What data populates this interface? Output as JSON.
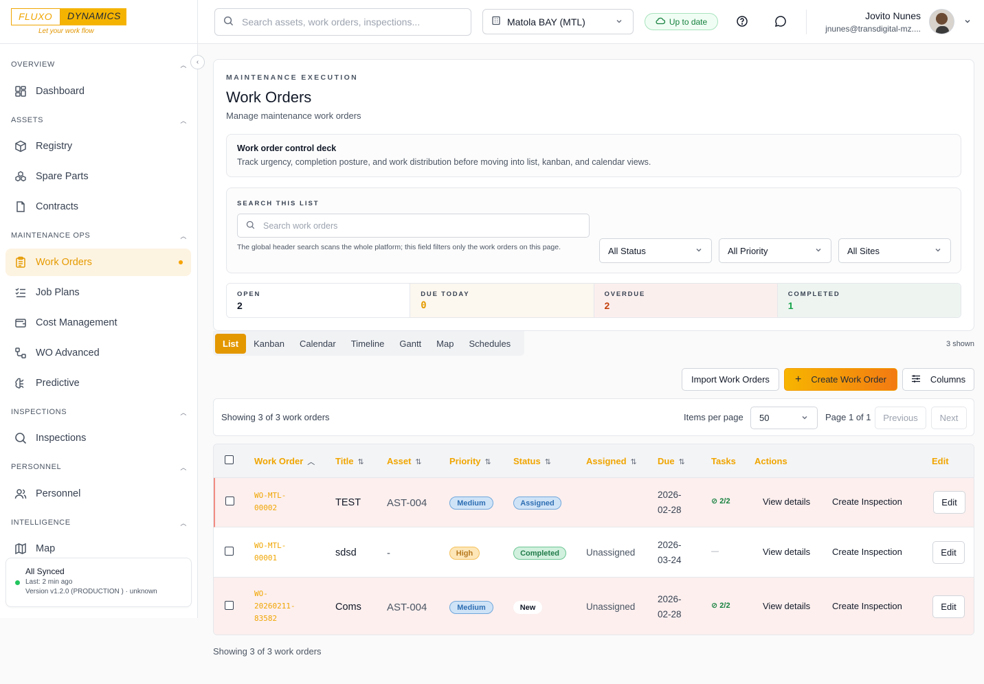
{
  "brand": {
    "left": "FLUXO",
    "right": "DYNAMICS",
    "tagline": "Let your work flow"
  },
  "sidebar": {
    "sections": [
      {
        "label": "OVERVIEW"
      },
      {
        "label": "ASSETS"
      },
      {
        "label": "MAINTENANCE OPS"
      },
      {
        "label": "INSPECTIONS"
      },
      {
        "label": "PERSONNEL"
      },
      {
        "label": "INTELLIGENCE"
      }
    ],
    "items": [
      {
        "label": "Dashboard",
        "icon": "dashboard-grid-icon"
      },
      {
        "label": "Registry",
        "icon": "box-icon"
      },
      {
        "label": "Spare Parts",
        "icon": "parts-icon"
      },
      {
        "label": "Contracts",
        "icon": "document-icon"
      },
      {
        "label": "Work Orders",
        "icon": "clipboard-icon",
        "active": true
      },
      {
        "label": "Job Plans",
        "icon": "checklist-icon"
      },
      {
        "label": "Cost Management",
        "icon": "wallet-icon"
      },
      {
        "label": "WO Advanced",
        "icon": "workflow-icon"
      },
      {
        "label": "Predictive",
        "icon": "brain-icon"
      },
      {
        "label": "Inspections",
        "icon": "search-icon"
      },
      {
        "label": "Personnel",
        "icon": "users-icon"
      },
      {
        "label": "Map",
        "icon": "map-icon"
      }
    ],
    "sync": {
      "title": "All Synced",
      "last": "Last: 2 min ago",
      "version": "Version v1.2.0 (PRODUCTION ) · unknown"
    }
  },
  "header": {
    "search_placeholder": "Search assets, work orders, inspections...",
    "site": "Matola BAY (MTL)",
    "status": "Up to date",
    "user_name": "Jovito Nunes",
    "user_email": "jnunes@transdigital-mz...."
  },
  "page": {
    "eyebrow": "MAINTENANCE EXECUTION",
    "title": "Work Orders",
    "subtitle": "Manage maintenance work orders",
    "deck_title": "Work order control deck",
    "deck_text": "Track urgency, completion posture, and work distribution before moving into list, kanban, and calendar views.",
    "search_eyebrow": "SEARCH THIS LIST",
    "search_placeholder": "Search work orders",
    "search_note": "The global header search scans the whole platform; this field filters only the work orders on this page.",
    "filters": {
      "status": "All Status",
      "priority": "All Priority",
      "sites": "All Sites"
    },
    "stats": [
      {
        "label": "OPEN",
        "value": "2",
        "color": "#111827",
        "bg": "#ffffff"
      },
      {
        "label": "DUE TODAY",
        "value": "0",
        "color": "#e59b00",
        "bg": "#fcf7ef"
      },
      {
        "label": "OVERDUE",
        "value": "2",
        "color": "#c2410c",
        "bg": "#fbefee"
      },
      {
        "label": "COMPLETED",
        "value": "1",
        "color": "#16a34a",
        "bg": "#eef5f1"
      }
    ]
  },
  "views": {
    "tabs": [
      "List",
      "Kanban",
      "Calendar",
      "Timeline",
      "Gantt",
      "Map",
      "Schedules"
    ],
    "shown": "3 shown"
  },
  "actions": {
    "import": "Import Work Orders",
    "create": "Create Work Order",
    "columns": "Columns"
  },
  "pager": {
    "showing": "Showing 3 of 3 work orders",
    "items_per_page_label": "Items per page",
    "items_per_page": "50",
    "page": "Page 1 of 1",
    "previous": "Previous",
    "next": "Next"
  },
  "table": {
    "columns": [
      "Work Order",
      "Title",
      "Asset",
      "Priority",
      "Status",
      "Assigned",
      "Due",
      "Tasks",
      "Actions",
      "Edit"
    ],
    "rows": [
      {
        "wo1": "WO-MTL-",
        "wo2": "00002",
        "wo3": "",
        "title": "TEST",
        "asset": "AST-004",
        "priority": "Medium",
        "status": "Assigned",
        "assigned": "",
        "due1": "2026-",
        "due2": "02-28",
        "tasks": "2/2",
        "view": "View details",
        "inspect": "Create Inspection",
        "edit": "Edit"
      },
      {
        "wo1": "WO-MTL-",
        "wo2": "00001",
        "wo3": "",
        "title": "sdsd",
        "asset": "-",
        "priority": "High",
        "status": "Completed",
        "assigned": "Unassigned",
        "due1": "2026-",
        "due2": "03-24",
        "tasks": "—",
        "view": "View details",
        "inspect": "Create Inspection",
        "edit": "Edit"
      },
      {
        "wo1": "WO-",
        "wo2": "20260211-",
        "wo3": "83582",
        "title": "Coms",
        "asset": "AST-004",
        "priority": "Medium",
        "status": "New",
        "assigned": "Unassigned",
        "due1": "2026-",
        "due2": "02-28",
        "tasks": "2/2",
        "view": "View details",
        "inspect": "Create Inspection",
        "edit": "Edit"
      }
    ]
  },
  "footer": {
    "showing": "Showing 3 of 3 work orders"
  }
}
